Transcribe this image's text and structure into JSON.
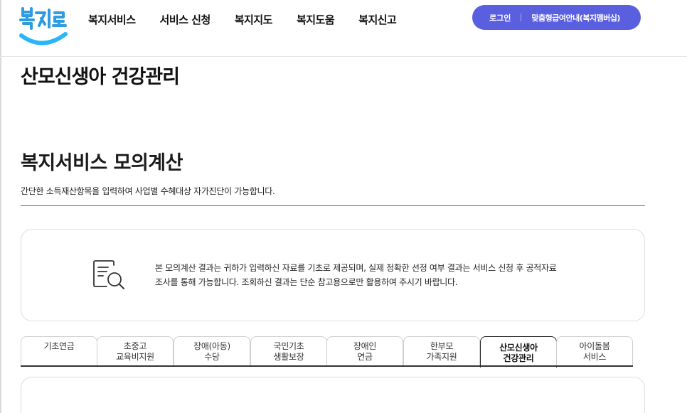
{
  "header": {
    "logo_text": "복지로",
    "nav": [
      "복지서비스",
      "서비스 신청",
      "복지지도",
      "복지도움",
      "복지신고"
    ],
    "login_label": "로그인",
    "member_label": "맞춤형급여안내(복지멤버십)"
  },
  "page_title": "산모신생아 건강관리",
  "section": {
    "title": "복지서비스 모의계산",
    "description": "간단한 소득재산항목을 입력하여 사업별 수혜대상 자가진단이 가능합니다."
  },
  "notice": {
    "icon": "document-search-icon",
    "line1": "본 모의계산 결과는 귀하가 입력하신 자료를 기초로 제공되며, 실제 정확한 선정 여부 결과는 서비스 신청 후 공적자료",
    "line2": "조사를 통해 가능합니다. 조회하신 결과는 단순 참고용으로만 활용하여 주시기 바랍니다."
  },
  "tabs": [
    {
      "line1": "기초연금",
      "line2": ""
    },
    {
      "line1": "초중고",
      "line2": "교육비지원"
    },
    {
      "line1": "장애(아동)",
      "line2": "수당"
    },
    {
      "line1": "국민기초",
      "line2": "생활보장"
    },
    {
      "line1": "장애인",
      "line2": "연금"
    },
    {
      "line1": "한부모",
      "line2": "가족지원"
    },
    {
      "line1": "산모신생아",
      "line2": "건강관리"
    },
    {
      "line1": "아이돌봄",
      "line2": "서비스"
    }
  ],
  "active_tab_index": 6,
  "colors": {
    "brand_blue": "#2f7fd8",
    "pill": "#5a5fe0",
    "rule": "#2a6fbf"
  }
}
